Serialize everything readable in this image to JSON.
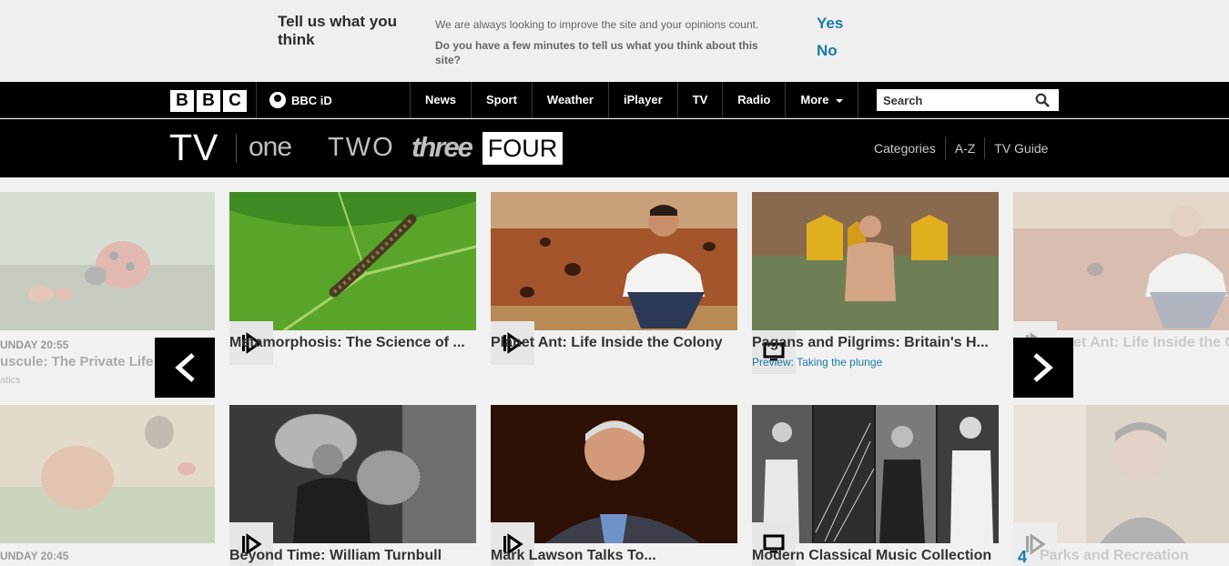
{
  "survey": {
    "title": "Tell us what you think",
    "line1": "We are always looking to improve the site and your opinions count.",
    "line2": "Do you have a few minutes to tell us what you think about this site?",
    "yes": "Yes",
    "no": "No"
  },
  "global": {
    "logo_letters": [
      "B",
      "B",
      "C"
    ],
    "bbcid": "BBC iD",
    "nav": [
      "News",
      "Sport",
      "Weather",
      "iPlayer",
      "TV",
      "Radio",
      "More"
    ],
    "search_placeholder": "Search"
  },
  "tv": {
    "logo": "TV",
    "channels": [
      "one",
      "TWO",
      "three",
      "FOUR"
    ],
    "active_channel": "FOUR",
    "nav": [
      "Categories",
      "A-Z",
      "TV Guide"
    ]
  },
  "row1": {
    "left_meta": "UNDAY 20:55",
    "left_title": "uscule: The Private Life",
    "left_sub": "atics",
    "cards": [
      {
        "title": "Metamorphosis: The Science of ...",
        "sub": "",
        "icon": "iplayer-icon"
      },
      {
        "title": "Planet Ant: Life Inside the Colony",
        "sub": "",
        "icon": "iplayer-icon"
      },
      {
        "title": "Pagans and Pilgrims: Britain's H...",
        "sub": "Preview: Taking the plunge",
        "icon": "tv-icon"
      }
    ],
    "right_title": "et Ant: Life Inside the C"
  },
  "row2": {
    "left_meta": "UNDAY 20:45",
    "cards": [
      {
        "title": "Beyond Time: William Turnbull",
        "icon": "iplayer-icon"
      },
      {
        "title": "Mark Lawson Talks To...",
        "icon": "iplayer-icon"
      },
      {
        "title": "Modern Classical Music Collection",
        "icon": "tv-icon"
      }
    ],
    "right_number": "4",
    "right_title": "Parks and Recreation"
  },
  "colors": {
    "accent_blue": "#1a7ba4",
    "bar_black": "#000000",
    "page_bg": "#f1f1f1"
  }
}
